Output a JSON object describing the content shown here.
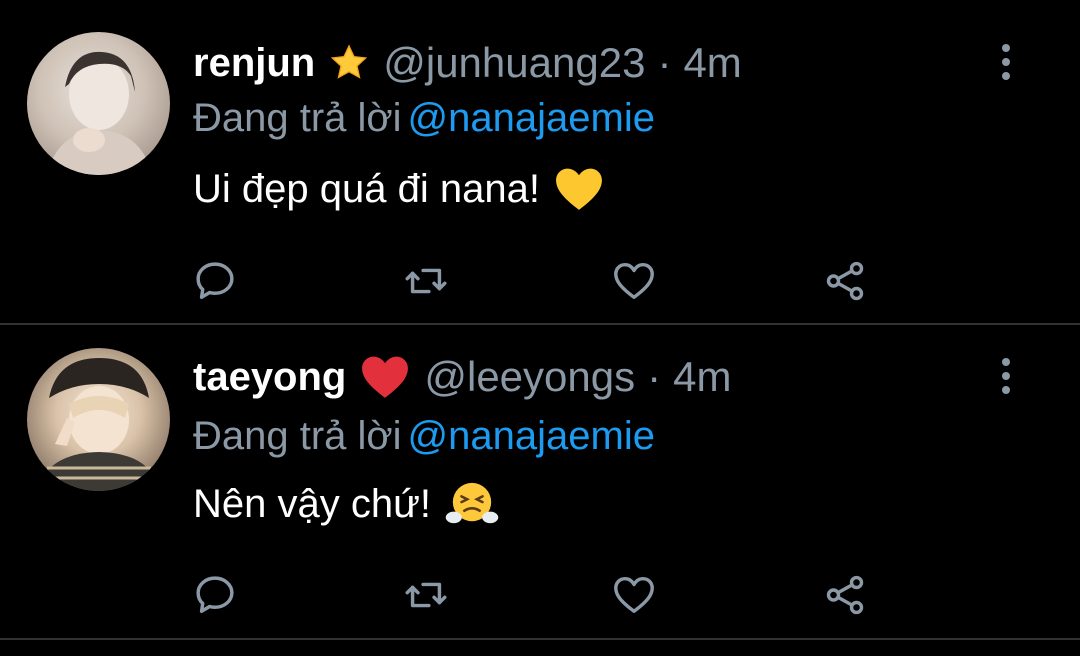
{
  "tweets": [
    {
      "name": "renjun",
      "badge_icon": "star-icon",
      "handle": "@junhuang23",
      "separator": "·",
      "time": "4m",
      "replying_label": "Đang trả lời",
      "replying_to": "@nanajaemie",
      "text": "Ui đẹp quá đi nana!",
      "text_emoji_icon": "yellow-heart-icon"
    },
    {
      "name": "taeyong",
      "badge_icon": "red-heart-icon",
      "handle": "@leeyongs",
      "separator": "·",
      "time": "4m",
      "replying_label": "Đang trả lời",
      "replying_to": "@nanajaemie",
      "text": "Nên vậy chứ!",
      "text_emoji_icon": "face-with-steam-icon"
    }
  ],
  "colors": {
    "background": "#000000",
    "primary_text": "#ffffff",
    "secondary_text": "#8b98a5",
    "link": "#1d9bf0",
    "divider": "#2f3336"
  },
  "actions": [
    "reply-icon",
    "retweet-icon",
    "like-icon",
    "share-icon"
  ]
}
